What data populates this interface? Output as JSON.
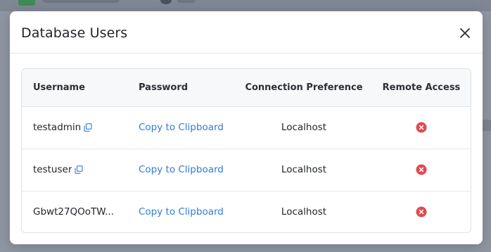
{
  "modal": {
    "title": "Database Users"
  },
  "table": {
    "headers": {
      "username": "Username",
      "password": "Password",
      "connection": "Connection Preference",
      "remote": "Remote Access"
    },
    "rows": [
      {
        "username": "testadmin",
        "password_action": "Copy to Clipboard",
        "connection": "Localhost",
        "remote_access": "disabled",
        "username_copy_icon": "copy-icon"
      },
      {
        "username": "testuser",
        "password_action": "Copy to Clipboard",
        "connection": "Localhost",
        "remote_access": "disabled",
        "username_copy_icon": "copy-icon"
      },
      {
        "username": "Gbwt27QOoTW...",
        "password_action": "Copy to Clipboard",
        "connection": "Localhost",
        "remote_access": "disabled",
        "username_copy_icon": ""
      }
    ]
  },
  "colors": {
    "link": "#2f7bd6",
    "status_red": "#e5484d"
  }
}
